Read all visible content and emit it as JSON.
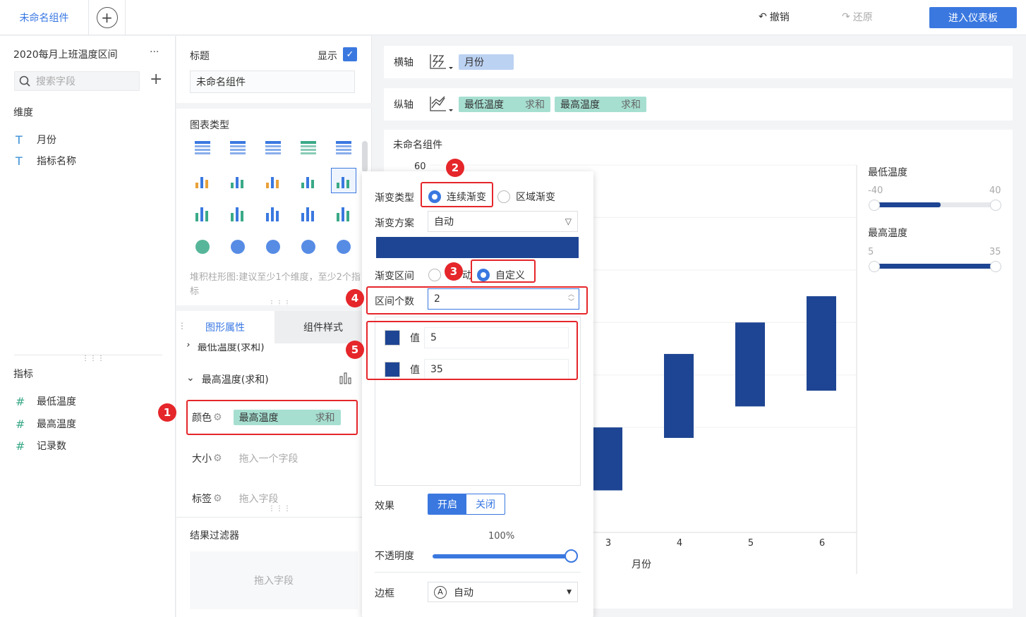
{
  "topbar": {
    "tab": "未命名组件",
    "undo": "撤销",
    "redo": "还原",
    "enter": "进入仪表板"
  },
  "left": {
    "dataset": "2020每月上班温度区间",
    "more": "···",
    "search_placeholder": "搜索字段",
    "dim_title": "维度",
    "dimensions": [
      {
        "icon": "T",
        "label": "月份"
      },
      {
        "icon": "T",
        "label": "指标名称"
      }
    ],
    "metric_title": "指标",
    "metrics": [
      {
        "icon": "#",
        "label": "最低温度"
      },
      {
        "icon": "#",
        "label": "最高温度"
      },
      {
        "icon": "#",
        "label": "记录数"
      }
    ]
  },
  "mid": {
    "title_label": "标题",
    "show_label": "显示",
    "title_value": "未命名组件",
    "chart_type_label": "图表类型",
    "hint": "堆积柱形图:建议至少1个维度，至少2个指标",
    "tab_shape": "图形属性",
    "tab_style": "组件样式",
    "prev_item": "最低温度(求和)",
    "series": "最高温度(求和)",
    "color_label": "颜色",
    "color_field": "最高温度",
    "color_agg": "求和",
    "size_label": "大小",
    "size_hint": "拖入一个字段",
    "tag_label": "标签",
    "tag_hint": "拖入字段",
    "filter_label": "结果过滤器",
    "filter_hint": "拖入字段"
  },
  "axes": {
    "x_label": "横轴",
    "x_field": "月份",
    "y_label": "纵轴",
    "y_fields": [
      {
        "name": "最低温度",
        "agg": "求和"
      },
      {
        "name": "最高温度",
        "agg": "求和"
      }
    ]
  },
  "chart": {
    "title": "未命名组件",
    "ytop": "60",
    "xlabel": "月份"
  },
  "chart_data": {
    "type": "bar",
    "categories": [
      "3",
      "4",
      "5",
      "6"
    ],
    "series": [
      {
        "name": "最高温度",
        "low": [
          -2,
          8,
          14,
          17
        ],
        "high": [
          10,
          24,
          30,
          35
        ]
      }
    ],
    "xlabel": "月份",
    "ylim": [
      -10,
      60
    ]
  },
  "legend": {
    "low_title": "最低温度",
    "low_min": "-40",
    "low_max": "40",
    "low_fill": 0.55,
    "high_title": "最高温度",
    "high_min": "5",
    "high_max": "35",
    "high_fill": 1.0
  },
  "popup": {
    "grad_type_label": "渐变类型",
    "grad_continuous": "连续渐变",
    "grad_area": "区域渐变",
    "scheme_label": "渐变方案",
    "scheme_value": "自动",
    "range_label": "渐变区间",
    "range_auto": "自动",
    "range_custom": "自定义",
    "count_label": "区间个数",
    "count_value": "2",
    "value_label": "值",
    "values": [
      "5",
      "35"
    ],
    "effect_label": "效果",
    "effect_on": "开启",
    "effect_off": "关闭",
    "opacity_value": "100%",
    "opacity_label": "不透明度",
    "border_label": "边框",
    "border_value": "自动",
    "color": "#1e4593"
  },
  "badges": [
    "1",
    "2",
    "3",
    "4",
    "5"
  ]
}
